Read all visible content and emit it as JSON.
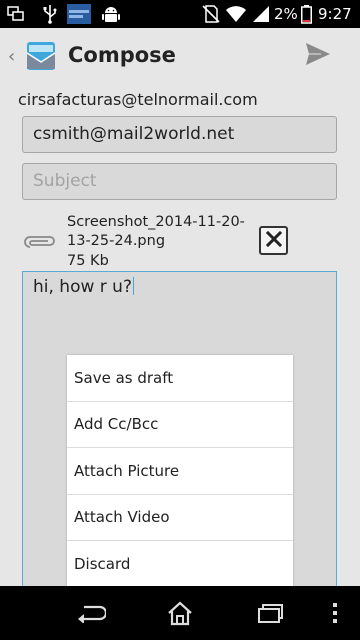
{
  "status_bar": {
    "battery_percent": "2%",
    "time": "9:27",
    "icons": [
      "screenshot-icon",
      "usb-icon",
      "blog-app-icon",
      "android-debug-icon",
      "no-sim-icon",
      "wifi-icon",
      "signal-icon",
      "battery-icon"
    ]
  },
  "action_bar": {
    "title": "Compose",
    "icons": [
      "up-caret-icon",
      "mail-app-icon",
      "send-icon"
    ]
  },
  "compose": {
    "from": "cirsafacturas@telnormail.com",
    "to_value": "csmith@mail2world.net",
    "subject_placeholder": "Subject",
    "body_text": "hi, how r u?",
    "attachment": {
      "name": "Screenshot_2014-11-20-13-25-24.png",
      "size": "75 Kb",
      "icons": [
        "paperclip-icon",
        "remove-attachment-icon"
      ]
    }
  },
  "menu": {
    "items": [
      "Save as draft",
      "Add Cc/Bcc",
      "Attach Picture",
      "Attach Video",
      "Discard"
    ]
  },
  "nav_bar": {
    "icons": [
      "back-icon",
      "home-icon",
      "recent-apps-icon",
      "overflow-menu-icon"
    ]
  },
  "colors": {
    "background": "#e6e6e6",
    "field": "#d9d9d9",
    "accent": "#4aa3df",
    "menu": "#ffffff"
  }
}
